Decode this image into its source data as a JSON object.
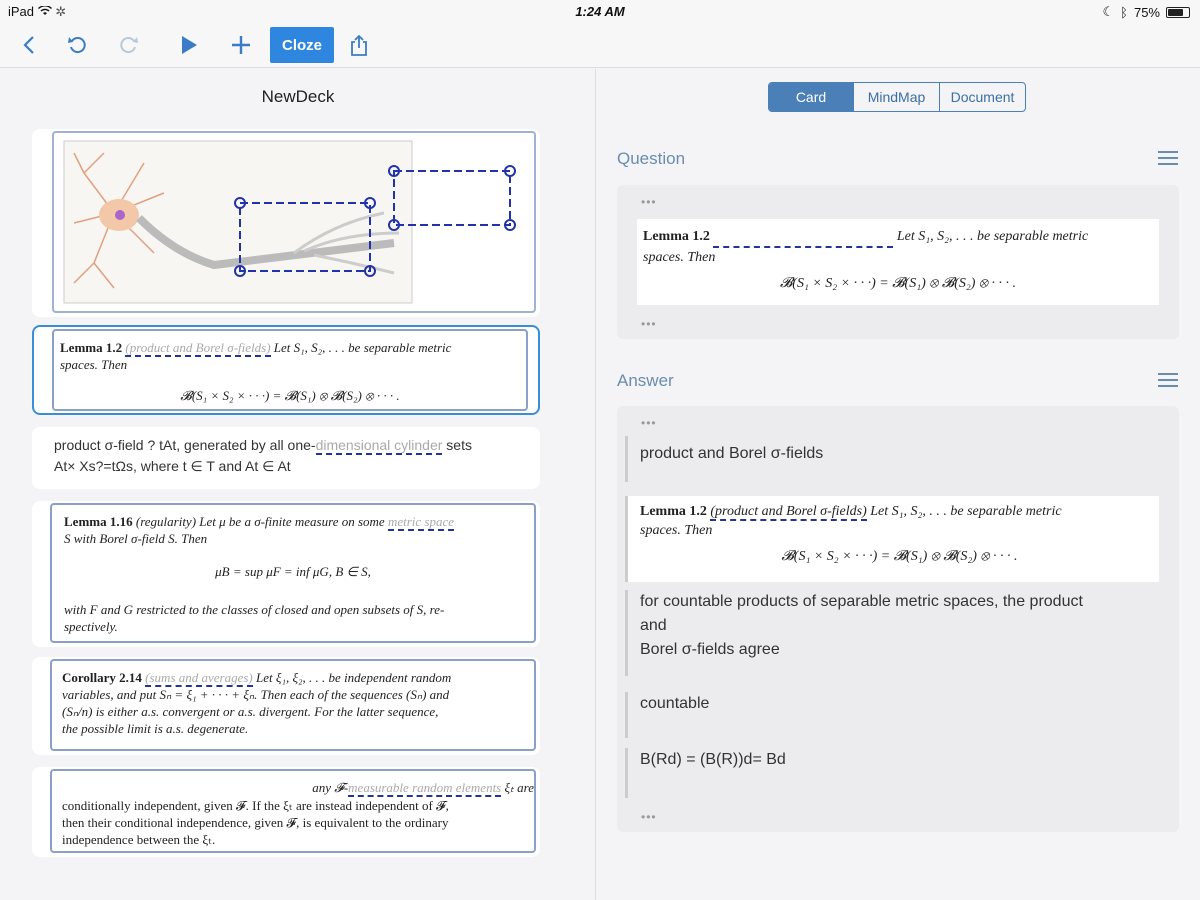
{
  "status": {
    "device": "iPad",
    "time": "1:24 AM",
    "battery": "75%",
    "battery_level": 0.75
  },
  "toolbar": {
    "cloze_label": "Cloze"
  },
  "deck": {
    "title": "NewDeck"
  },
  "cards": {
    "lemma12": {
      "title": "Lemma 1.2",
      "cloze": "(product and Borel σ-fields)",
      "text1": "Let S₁, S₂, . . . be separable metric",
      "text2": "spaces. Then",
      "formula": "𝓑(S₁ × S₂ × · · ·) = 𝓑(S₁) ⊗ 𝓑(S₂) ⊗ · · · ."
    },
    "plain": {
      "line1a": "product σ-field ? tAt, generated by all one-",
      "cloze": "dimensional cylinder",
      "line1b": " sets",
      "line2": "At× Xs?=tΩs, where t ∈ T and At ∈ At"
    },
    "lemma116": {
      "title": "Lemma 1.16",
      "tag": "(regularity)",
      "text1": "Let μ be a σ-finite measure on some",
      "cloze": "metric space",
      "text2": "S with Borel σ-field S. Then",
      "formula": "μB = sup μF = inf μG,    B ∈ S,",
      "text3": "with F and G restricted to the classes of closed and open subsets of S, re-",
      "text4": "spectively."
    },
    "corollary": {
      "title": "Corollary 2.14",
      "cloze": "(sums and averages)",
      "text1": "Let ξ₁, ξ₂, . . . be independent random",
      "text2": "variables, and put Sₙ = ξ₁ + · · · + ξₙ. Then each of the sequences (Sₙ) and",
      "text3": "(Sₙ/n) is either a.s. convergent or a.s. divergent. For the latter sequence,",
      "text4": "the possible limit is a.s. degenerate."
    },
    "independence": {
      "text0": "any 𝓕-",
      "cloze": "measurable random elements",
      "text0b": " ξₜ are",
      "text1": "conditionally independent, given 𝓕. If the ξₜ are instead independent of 𝓕,",
      "text2": "then their conditional independence, given 𝓕, is equivalent to the ordinary",
      "text3": "independence between the ξₜ."
    }
  },
  "tabs": [
    "Card",
    "MindMap",
    "Document"
  ],
  "question": {
    "label": "Question",
    "dots": "•••",
    "title": "Lemma 1.2",
    "text1": "Let S₁, S₂, . . . be separable metric",
    "text2": "spaces. Then",
    "formula": "𝓑(S₁ × S₂ × · · ·) = 𝓑(S₁) ⊗ 𝓑(S₂) ⊗ · · · ."
  },
  "answer": {
    "label": "Answer",
    "dots": "•••",
    "a1": "product and Borel σ-fields",
    "lemma_title": "Lemma 1.2",
    "lemma_cloze": "(product and Borel σ-fields)",
    "lemma_text1": "Let S₁, S₂, . . . be separable metric",
    "lemma_text2": "spaces. Then",
    "lemma_formula": "𝓑(S₁ × S₂ × · · ·) = 𝓑(S₁) ⊗ 𝓑(S₂) ⊗ · · · .",
    "a2_line1": "for countable products of separable metric spaces, the product",
    "a2_line2": "and",
    "a2_line3": "Borel σ-fields agree",
    "a3": "countable",
    "a4": "B(Rd) = (B(R))d= Bd"
  }
}
